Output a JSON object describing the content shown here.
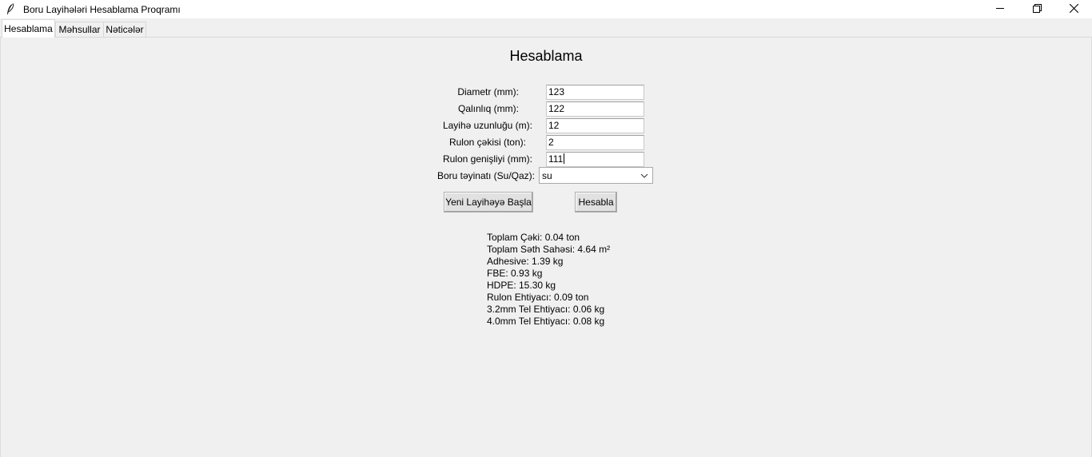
{
  "window": {
    "title": "Boru Layihələri Hesablama Proqramı",
    "controls": [
      "minimize-icon",
      "maximize-icon",
      "close-icon"
    ]
  },
  "tabs": [
    {
      "label": "Hesablama",
      "active": true
    },
    {
      "label": "Məhsullar",
      "active": false
    },
    {
      "label": "Nəticələr",
      "active": false
    }
  ],
  "main": {
    "title": "Hesablama",
    "fields": {
      "diameter": {
        "label": "Diametr (mm):",
        "value": "123"
      },
      "thickness": {
        "label": "Qalınlıq (mm):",
        "value": "122"
      },
      "length": {
        "label": "Layihə uzunluğu (m):",
        "value": "12"
      },
      "coil_weight": {
        "label": "Rulon çəkisi (ton):",
        "value": "2"
      },
      "coil_width": {
        "label": "Rulon genişliyi (mm):",
        "value": "111"
      },
      "purpose": {
        "label": "Boru təyinatı (Su/Qaz):",
        "value": "su"
      }
    },
    "buttons": {
      "new_project": "Yeni Layihəyə Başla",
      "calculate": "Hesabla"
    },
    "results": [
      "Toplam Çəki: 0.04 ton",
      "Toplam Səth Sahəsi: 4.64 m²",
      "Adhesive: 1.39 kg",
      "FBE: 0.93 kg",
      "HDPE: 15.30 kg",
      "Rulon Ehtiyacı: 0.09 ton",
      "3.2mm Tel Ehtiyacı: 0.06 kg",
      "4.0mm Tel Ehtiyacı: 0.08 kg"
    ]
  }
}
